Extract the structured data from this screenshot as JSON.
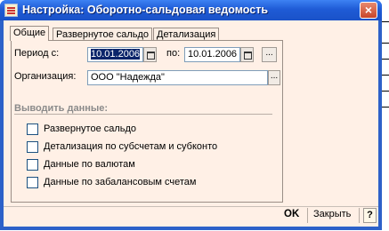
{
  "window": {
    "title": "Настройка: Оборотно-сальдовая ведомость",
    "close_glyph": "×"
  },
  "tabs": [
    {
      "label": "Общие"
    },
    {
      "label": "Развернутое сальдо"
    },
    {
      "label": "Детализация"
    }
  ],
  "form": {
    "period_label": "Период с:",
    "date_from": "10.01.2006",
    "to_label": "по:",
    "date_to": "10.01.2006",
    "org_label": "Организация:",
    "org_value": "ООО \"Надежда\"",
    "more_glyph": "..."
  },
  "output_section": {
    "title": "Выводить данные:",
    "options": [
      {
        "label": "Развернутое сальдо",
        "checked": false
      },
      {
        "label": "Детализация по субсчетам и субконто",
        "checked": false
      },
      {
        "label": "Данные по валютам",
        "checked": false
      },
      {
        "label": "Данные по забалансовым счетам",
        "checked": false
      }
    ]
  },
  "footer": {
    "ok_label": "OK",
    "close_label": "Закрыть",
    "help_label": "?"
  }
}
